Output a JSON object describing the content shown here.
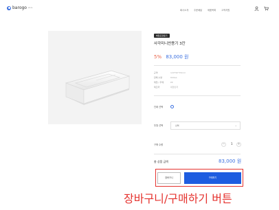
{
  "header": {
    "logo_text": "barogo",
    "logo_sup": "store",
    "nav": [
      "회사소개",
      "주문배달",
      "제품목록",
      "고객지원"
    ]
  },
  "product": {
    "badge": "배달포장용기",
    "title": "사각미니찬용기 3칸",
    "original_price": "",
    "discount_pct": "5%",
    "price": "83,000 원",
    "info": [
      {
        "key": "규격",
        "value": "120*90*35mm"
      },
      {
        "key": "판매 수량",
        "value": "600ea"
      },
      {
        "key": "재질 / 두께",
        "value": "PP"
      },
      {
        "key": "제조국",
        "value": "대한민국"
      }
    ]
  },
  "options": {
    "print_label": "인쇄 선택",
    "lid_label": "뚜껑 선택",
    "lid_value": "선택",
    "qty_label": "구매 수량",
    "qty_value": "1",
    "minus": "−",
    "plus": "+"
  },
  "total": {
    "label": "총 상품 금액",
    "value": "83,000 원"
  },
  "buttons": {
    "cart": "장바구니",
    "buy": "구매하기"
  },
  "caption": "장바구니/구매하기 버튼",
  "colors": {
    "accent": "#1e5de0",
    "price": "#3a6fe0",
    "discount": "#e8634a",
    "highlight": "#e5322e"
  }
}
